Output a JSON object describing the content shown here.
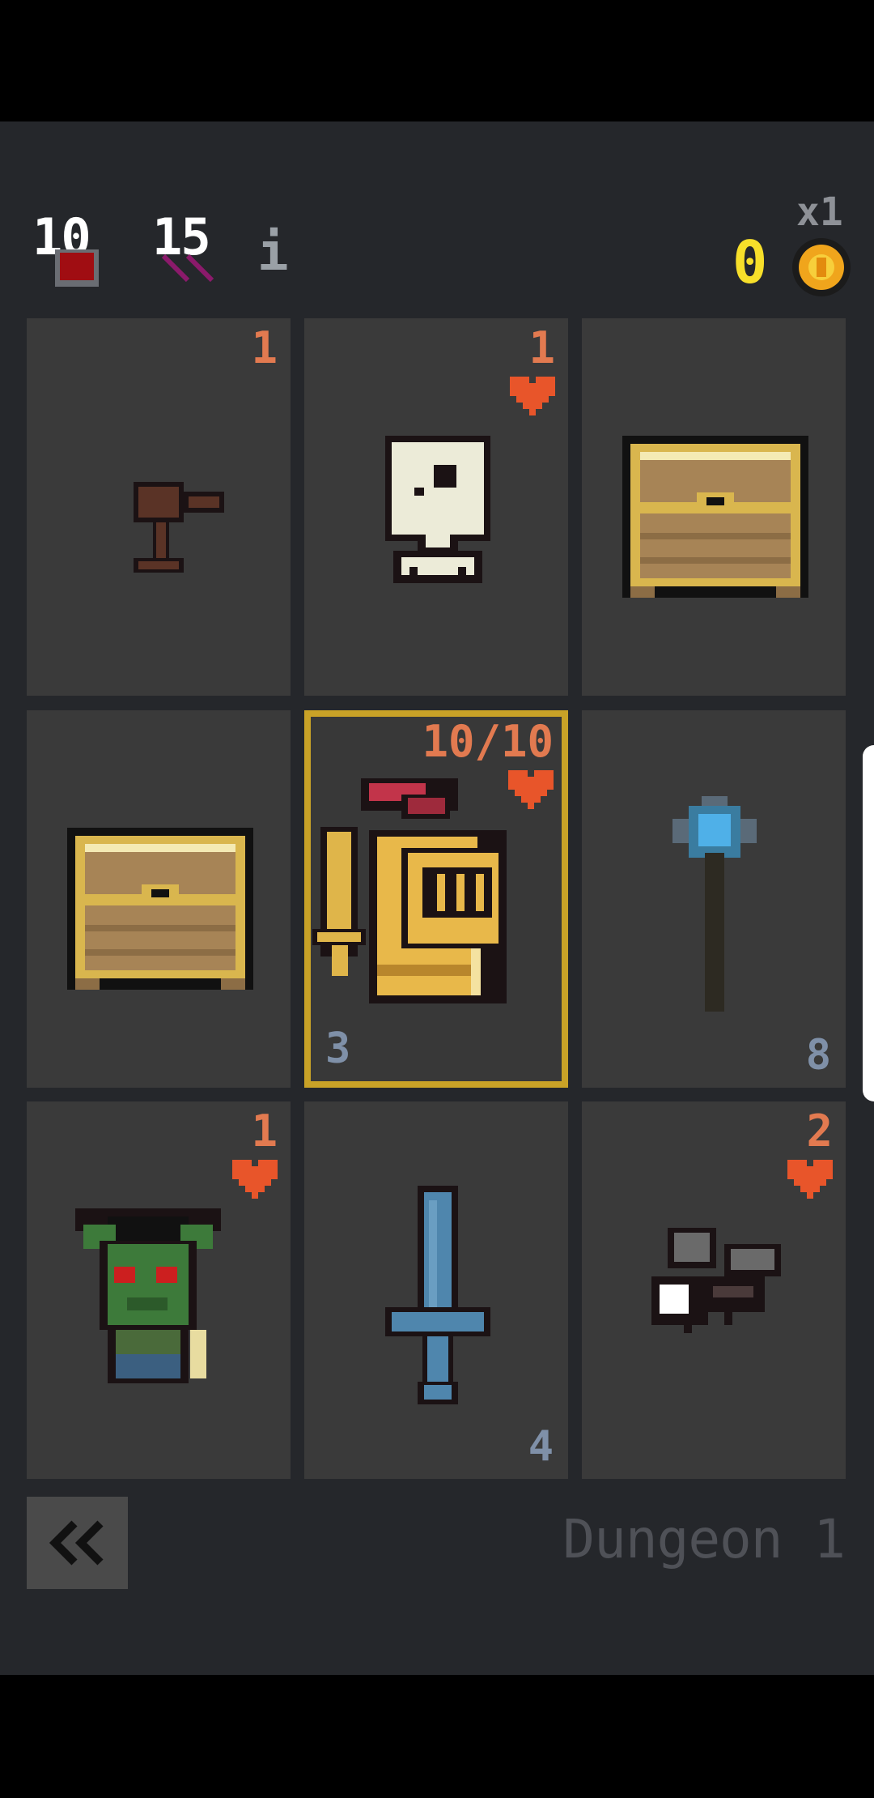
{
  "hud": {
    "health": "10",
    "attack": "15",
    "info_label": "i",
    "gold": "0",
    "multiplier": "x1"
  },
  "tiles": [
    {
      "label": "Hammer weapon card",
      "top_value": "1",
      "icon": "hammer-icon"
    },
    {
      "label": "Skeleton enemy card",
      "top_value": "1",
      "icon": "skeleton-icon",
      "heart": true
    },
    {
      "label": "Treasure chest card",
      "icon": "treasure-chest-icon"
    },
    {
      "label": "Treasure chest card",
      "icon": "treasure-chest-icon"
    },
    {
      "label": "Knight hero card",
      "top_value": "10/10",
      "bottom_value": "3",
      "icon": "knight-icon",
      "heart": true
    },
    {
      "label": "Magic staff card",
      "bottom_value": "8",
      "icon": "staff-icon"
    },
    {
      "label": "Goblin enemy card",
      "top_value": "1",
      "icon": "goblin-icon",
      "heart": true
    },
    {
      "label": "Sword weapon card",
      "bottom_value": "4",
      "icon": "sword-icon"
    },
    {
      "label": "Fly enemy card",
      "top_value": "2",
      "icon": "fly-icon",
      "heart": true
    }
  ],
  "footer": {
    "back_icon": "double-chevron-left-icon",
    "level_name": "Dungeon 1"
  },
  "colors": {
    "background": "#25272b",
    "tile": "#3a3a3a",
    "hero_border": "#c9a227",
    "enemy_value": "#e27a50",
    "item_value": "#7f90a8",
    "heart": "#e8552a",
    "gold": "#f7df2a"
  }
}
